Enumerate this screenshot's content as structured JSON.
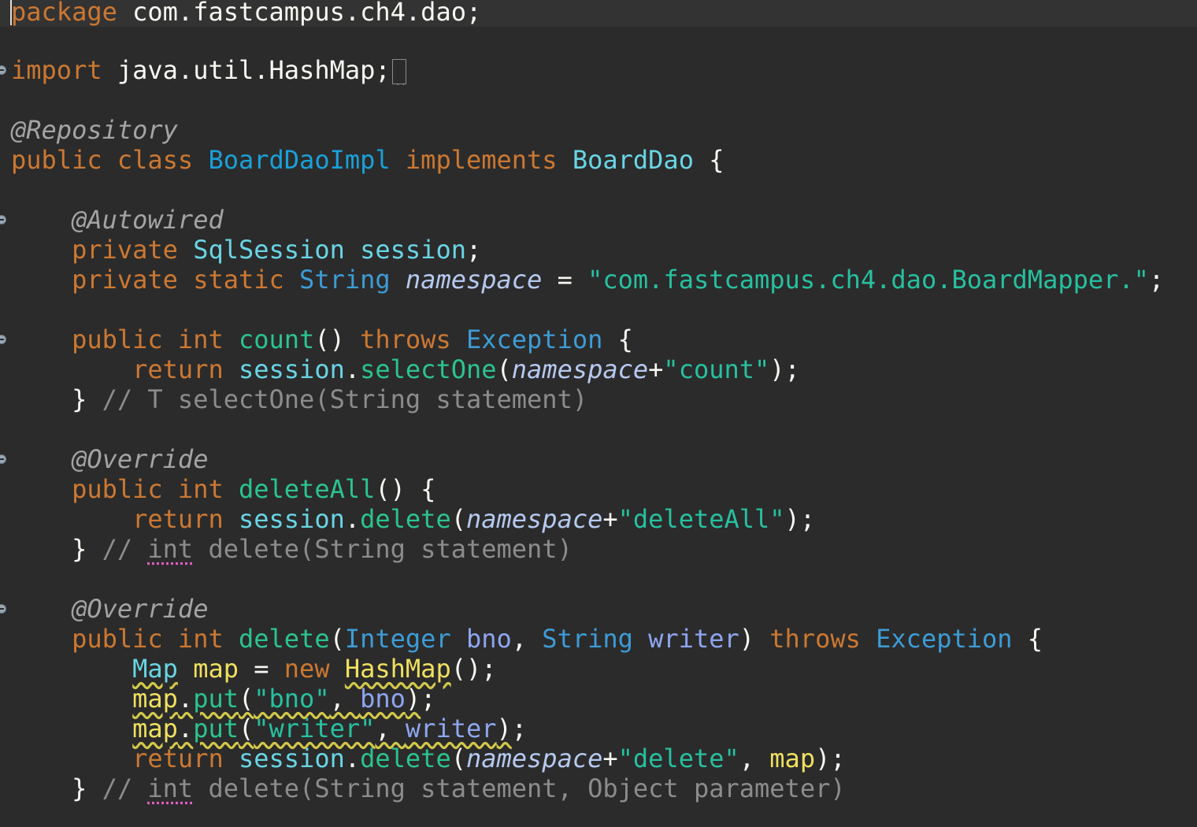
{
  "editor": {
    "language": "Java",
    "theme_colors": {
      "background": "#2b2b2b",
      "keyword": "#cc7832",
      "annotation": "#a4a4a4",
      "class_name": "#1aa0d8",
      "method": "#2bc48e",
      "string": "#27c0a0",
      "comment": "#8c8c8c",
      "local_variable": "#f0e060"
    }
  },
  "code": {
    "l1": {
      "kw_package": "package",
      "package_name": " com.fastcampus.ch4.dao;"
    },
    "l3": {
      "kw_import": "import",
      "import_name": " java.util.HashMap;"
    },
    "l5": {
      "annotation": "@Repository"
    },
    "l6": {
      "kw_public": "public",
      "kw_class": "class",
      "class_name": "BoardDaoImpl",
      "kw_implements": "implements",
      "interface_name": "BoardDao",
      "brace": " {"
    },
    "l8": {
      "annotation": "@Autowired"
    },
    "l9": {
      "kw_private": "private",
      "type": "SqlSession",
      "field": "session",
      "semi": ";"
    },
    "l10": {
      "kw_private": "private",
      "kw_static": "static",
      "type": "String",
      "field": "namespace",
      "op": " = ",
      "value": "\"com.fastcampus.ch4.dao.BoardMapper.\"",
      "semi": ";"
    },
    "l12": {
      "kw_public": "public",
      "kw_int": "int",
      "method": "count",
      "parens": "() ",
      "kw_throws": "throws",
      "exception": "Exception",
      "brace": " {"
    },
    "l13": {
      "kw_return": "return",
      "obj": "session",
      "dot": ".",
      "call": "selectOne",
      "open": "(",
      "arg": "namespace",
      "plus": "+",
      "str": "\"count\"",
      "close": ");"
    },
    "l14": {
      "brace": "}",
      "comment": "// T selectOne(String statement)"
    },
    "l16": {
      "annotation": "@Override"
    },
    "l17": {
      "kw_public": "public",
      "kw_int": "int",
      "method": "deleteAll",
      "parens": "() {"
    },
    "l18": {
      "kw_return": "return",
      "obj": "session",
      "dot": ".",
      "call": "delete",
      "open": "(",
      "arg": "namespace",
      "plus": "+",
      "str": "\"deleteAll\"",
      "close": ");"
    },
    "l19": {
      "brace": "}",
      "comment_start": "// ",
      "comment_int": "int",
      "comment_rest": " delete(String statement)"
    },
    "l21": {
      "annotation": "@Override"
    },
    "l22": {
      "kw_public": "public",
      "kw_int": "int",
      "method": "delete",
      "open": "(",
      "type1": "Integer",
      "param1": "bno",
      "comma": ", ",
      "type2": "String",
      "param2": "writer",
      "close": ") ",
      "kw_throws": "throws",
      "exception": "Exception",
      "brace": " {"
    },
    "l23": {
      "type": "Map",
      "var": "map",
      "op": " = ",
      "kw_new": "new",
      "ctor": "HashMap",
      "end": "();"
    },
    "l24": {
      "obj": "map",
      "dot": ".",
      "call": "put",
      "open": "(",
      "str": "\"bno\"",
      "comma": ", ",
      "arg": "bno",
      "close": ")",
      "semi": ";"
    },
    "l25": {
      "obj": "map",
      "dot": ".",
      "call": "put",
      "open": "(",
      "str": "\"writer\"",
      "comma": ", ",
      "arg": "writer",
      "close": ")",
      "semi": ";"
    },
    "l26": {
      "kw_return": "return",
      "obj": "session",
      "dot": ".",
      "call": "delete",
      "open": "(",
      "arg": "namespace",
      "plus": "+",
      "str": "\"delete\"",
      "comma": ", ",
      "arg2": "map",
      "close": ");"
    },
    "l27": {
      "brace": "}",
      "comment_start": "// ",
      "comment_int": "int",
      "comment_rest": " delete(String statement, Object parameter)"
    }
  }
}
